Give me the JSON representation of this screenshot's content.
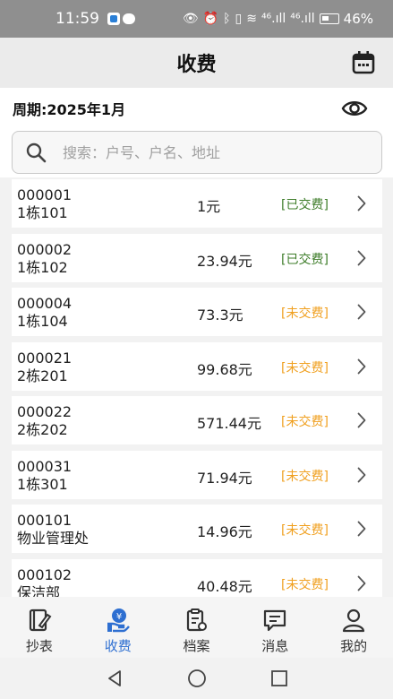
{
  "status_bar": {
    "time": "11:59",
    "battery": "46%",
    "signal_label_1": "⁴⁶",
    "signal_label_2": "⁴⁶"
  },
  "header": {
    "title": "收费"
  },
  "period": {
    "label": "周期:2025年1月"
  },
  "search": {
    "placeholder": "搜索：户号、户名、地址"
  },
  "records": [
    {
      "id": "000001",
      "name": "1栋101",
      "amount": "1元",
      "status": "[已交费]",
      "paid": true
    },
    {
      "id": "000002",
      "name": "1栋102",
      "amount": "23.94元",
      "status": "[已交费]",
      "paid": true
    },
    {
      "id": "000004",
      "name": "1栋104",
      "amount": "73.3元",
      "status": "[未交费]",
      "paid": false
    },
    {
      "id": "000021",
      "name": "2栋201",
      "amount": "99.68元",
      "status": "[未交费]",
      "paid": false
    },
    {
      "id": "000022",
      "name": "2栋202",
      "amount": "571.44元",
      "status": "[未交费]",
      "paid": false
    },
    {
      "id": "000031",
      "name": "1栋301",
      "amount": "71.94元",
      "status": "[未交费]",
      "paid": false
    },
    {
      "id": "000101",
      "name": "物业管理处",
      "amount": "14.96元",
      "status": "[未交费]",
      "paid": false
    },
    {
      "id": "000102",
      "name": "保洁部",
      "amount": "40.48元",
      "status": "[未交费]",
      "paid": false
    }
  ],
  "tabs": [
    {
      "label": "抄表",
      "icon": "meter-icon",
      "active": false
    },
    {
      "label": "收费",
      "icon": "payment-icon",
      "active": true
    },
    {
      "label": "档案",
      "icon": "archive-icon",
      "active": false
    },
    {
      "label": "消息",
      "icon": "message-icon",
      "active": false
    },
    {
      "label": "我的",
      "icon": "profile-icon",
      "active": false
    }
  ],
  "colors": {
    "paid": "#3e7d2a",
    "unpaid": "#f0a020",
    "active_tab": "#2e6fd1"
  }
}
